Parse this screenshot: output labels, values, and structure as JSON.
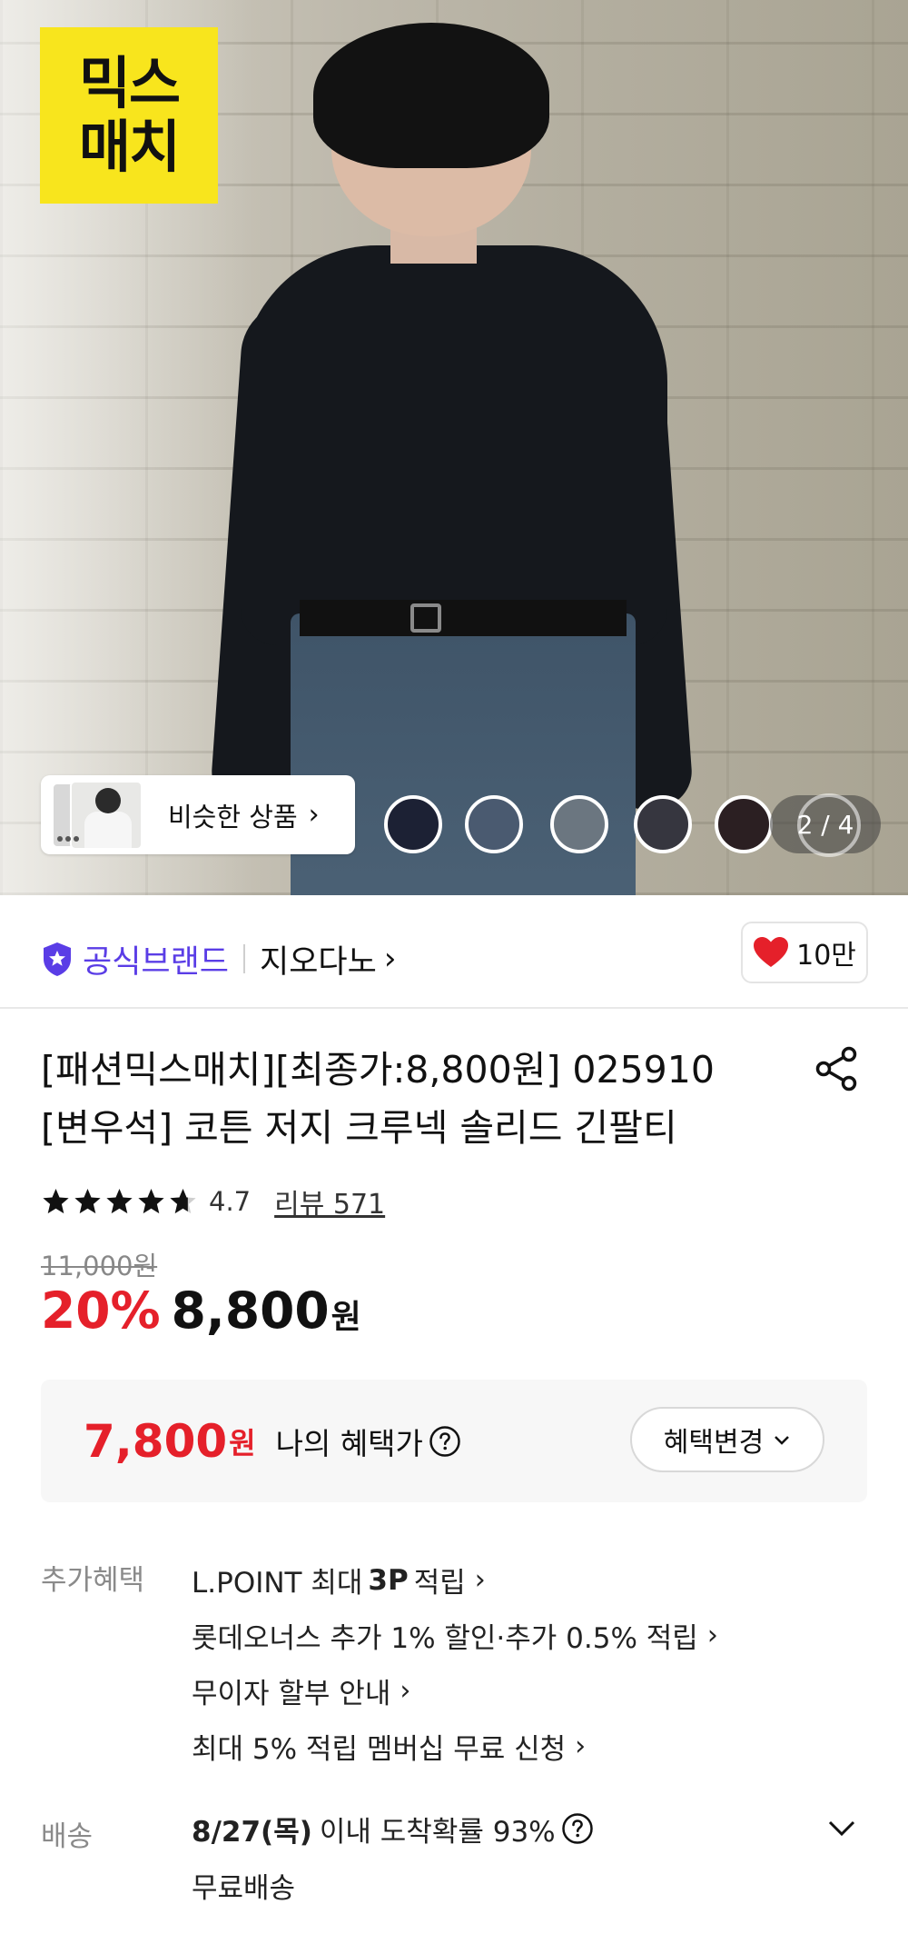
{
  "hero": {
    "logo_line1": "믹스",
    "logo_line2": "매치",
    "similar_label": "비슷한 상품",
    "pager": "2 / 4"
  },
  "brand": {
    "official_label": "공식브랜드",
    "name": "지오다노",
    "likes": "10만"
  },
  "product": {
    "title_line1": "[패션믹스매치][최종가:8,800원] 025910",
    "title_line2": "[변우석] 코튼 저지 크루넥 솔리드 긴팔티",
    "rating": "4.7",
    "rating_stars": 4.7,
    "review_link": "리뷰 571",
    "original_price": "11,000원",
    "discount": "20%",
    "sale_price": "8,800",
    "currency": "원"
  },
  "benefit": {
    "price": "7,800",
    "currency": "원",
    "label": "나의 혜택가",
    "change_button": "혜택변경"
  },
  "extra": {
    "label": "추가혜택",
    "items": [
      {
        "pre": "L.POINT 최대",
        "bold": "3P",
        "post": "적립"
      },
      {
        "text": "롯데오너스 추가 1% 할인·추가 0.5% 적립"
      },
      {
        "text": "무이자 할부 안내"
      },
      {
        "text": "최대 5% 적립 멤버십 무료 신청"
      }
    ]
  },
  "shipping": {
    "label": "배송",
    "date": "8/27(목)",
    "text": "이내 도착확률 93%",
    "fee": "무료배송"
  },
  "colors": {
    "accent_red": "#e5202a",
    "brand_purple": "#5a3de6",
    "logo_yellow": "#f8e51d"
  }
}
